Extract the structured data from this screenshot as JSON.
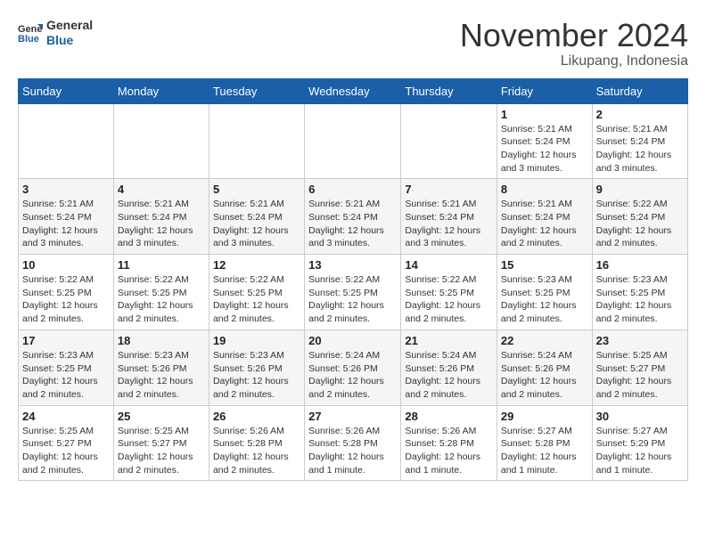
{
  "header": {
    "logo_line1": "General",
    "logo_line2": "Blue",
    "month_title": "November 2024",
    "subtitle": "Likupang, Indonesia"
  },
  "weekdays": [
    "Sunday",
    "Monday",
    "Tuesday",
    "Wednesday",
    "Thursday",
    "Friday",
    "Saturday"
  ],
  "weeks": [
    [
      {
        "day": "",
        "info": ""
      },
      {
        "day": "",
        "info": ""
      },
      {
        "day": "",
        "info": ""
      },
      {
        "day": "",
        "info": ""
      },
      {
        "day": "",
        "info": ""
      },
      {
        "day": "1",
        "info": "Sunrise: 5:21 AM\nSunset: 5:24 PM\nDaylight: 12 hours and 3 minutes."
      },
      {
        "day": "2",
        "info": "Sunrise: 5:21 AM\nSunset: 5:24 PM\nDaylight: 12 hours and 3 minutes."
      }
    ],
    [
      {
        "day": "3",
        "info": "Sunrise: 5:21 AM\nSunset: 5:24 PM\nDaylight: 12 hours and 3 minutes."
      },
      {
        "day": "4",
        "info": "Sunrise: 5:21 AM\nSunset: 5:24 PM\nDaylight: 12 hours and 3 minutes."
      },
      {
        "day": "5",
        "info": "Sunrise: 5:21 AM\nSunset: 5:24 PM\nDaylight: 12 hours and 3 minutes."
      },
      {
        "day": "6",
        "info": "Sunrise: 5:21 AM\nSunset: 5:24 PM\nDaylight: 12 hours and 3 minutes."
      },
      {
        "day": "7",
        "info": "Sunrise: 5:21 AM\nSunset: 5:24 PM\nDaylight: 12 hours and 3 minutes."
      },
      {
        "day": "8",
        "info": "Sunrise: 5:21 AM\nSunset: 5:24 PM\nDaylight: 12 hours and 2 minutes."
      },
      {
        "day": "9",
        "info": "Sunrise: 5:22 AM\nSunset: 5:24 PM\nDaylight: 12 hours and 2 minutes."
      }
    ],
    [
      {
        "day": "10",
        "info": "Sunrise: 5:22 AM\nSunset: 5:25 PM\nDaylight: 12 hours and 2 minutes."
      },
      {
        "day": "11",
        "info": "Sunrise: 5:22 AM\nSunset: 5:25 PM\nDaylight: 12 hours and 2 minutes."
      },
      {
        "day": "12",
        "info": "Sunrise: 5:22 AM\nSunset: 5:25 PM\nDaylight: 12 hours and 2 minutes."
      },
      {
        "day": "13",
        "info": "Sunrise: 5:22 AM\nSunset: 5:25 PM\nDaylight: 12 hours and 2 minutes."
      },
      {
        "day": "14",
        "info": "Sunrise: 5:22 AM\nSunset: 5:25 PM\nDaylight: 12 hours and 2 minutes."
      },
      {
        "day": "15",
        "info": "Sunrise: 5:23 AM\nSunset: 5:25 PM\nDaylight: 12 hours and 2 minutes."
      },
      {
        "day": "16",
        "info": "Sunrise: 5:23 AM\nSunset: 5:25 PM\nDaylight: 12 hours and 2 minutes."
      }
    ],
    [
      {
        "day": "17",
        "info": "Sunrise: 5:23 AM\nSunset: 5:25 PM\nDaylight: 12 hours and 2 minutes."
      },
      {
        "day": "18",
        "info": "Sunrise: 5:23 AM\nSunset: 5:26 PM\nDaylight: 12 hours and 2 minutes."
      },
      {
        "day": "19",
        "info": "Sunrise: 5:23 AM\nSunset: 5:26 PM\nDaylight: 12 hours and 2 minutes."
      },
      {
        "day": "20",
        "info": "Sunrise: 5:24 AM\nSunset: 5:26 PM\nDaylight: 12 hours and 2 minutes."
      },
      {
        "day": "21",
        "info": "Sunrise: 5:24 AM\nSunset: 5:26 PM\nDaylight: 12 hours and 2 minutes."
      },
      {
        "day": "22",
        "info": "Sunrise: 5:24 AM\nSunset: 5:26 PM\nDaylight: 12 hours and 2 minutes."
      },
      {
        "day": "23",
        "info": "Sunrise: 5:25 AM\nSunset: 5:27 PM\nDaylight: 12 hours and 2 minutes."
      }
    ],
    [
      {
        "day": "24",
        "info": "Sunrise: 5:25 AM\nSunset: 5:27 PM\nDaylight: 12 hours and 2 minutes."
      },
      {
        "day": "25",
        "info": "Sunrise: 5:25 AM\nSunset: 5:27 PM\nDaylight: 12 hours and 2 minutes."
      },
      {
        "day": "26",
        "info": "Sunrise: 5:26 AM\nSunset: 5:28 PM\nDaylight: 12 hours and 2 minutes."
      },
      {
        "day": "27",
        "info": "Sunrise: 5:26 AM\nSunset: 5:28 PM\nDaylight: 12 hours and 1 minute."
      },
      {
        "day": "28",
        "info": "Sunrise: 5:26 AM\nSunset: 5:28 PM\nDaylight: 12 hours and 1 minute."
      },
      {
        "day": "29",
        "info": "Sunrise: 5:27 AM\nSunset: 5:28 PM\nDaylight: 12 hours and 1 minute."
      },
      {
        "day": "30",
        "info": "Sunrise: 5:27 AM\nSunset: 5:29 PM\nDaylight: 12 hours and 1 minute."
      }
    ]
  ]
}
